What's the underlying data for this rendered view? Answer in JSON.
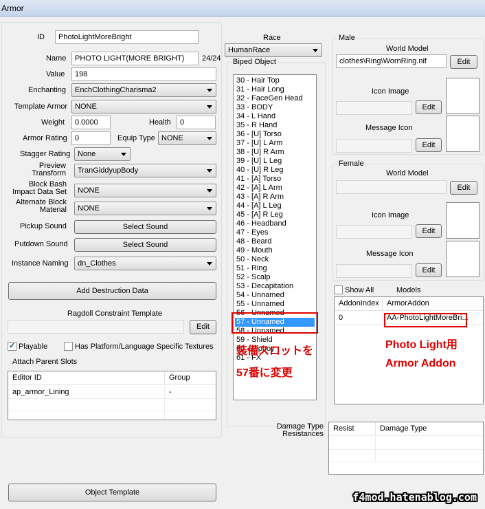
{
  "window": {
    "title": "Armor"
  },
  "form": {
    "id_label": "ID",
    "id_value": "PhotoLightMoreBright",
    "name_label": "Name",
    "name_value": "PHOTO LIGHT(MORE BRIGHT)",
    "name_count": "24/24",
    "value_label": "Value",
    "value_value": "198",
    "enchanting_label": "Enchanting",
    "enchanting_value": "EnchClothingCharisma2",
    "template_armor_label": "Template Armor",
    "template_armor_value": "NONE",
    "weight_label": "Weight",
    "weight_value": "0.0000",
    "health_label": "Health",
    "health_value": "0",
    "armor_rating_label": "Armor Rating",
    "armor_rating_value": "0",
    "equip_type_label": "Equip Type",
    "equip_type_value": "NONE",
    "stagger_label": "Stagger Rating",
    "stagger_value": "None",
    "preview_label_1": "Preview",
    "preview_label_2": "Transform",
    "preview_value": "TranGiddyupBody",
    "block_bash_label_1": "Block Bash",
    "block_bash_label_2": "Impact Data Set",
    "block_bash_value": "NONE",
    "alt_block_label_1": "Alternate Block",
    "alt_block_label_2": "Material",
    "alt_block_value": "NONE",
    "pickup_label": "Pickup Sound",
    "pickup_button": "Select Sound",
    "putdown_label": "Putdown Sound",
    "putdown_button": "Select Sound",
    "instance_label": "Instance Naming",
    "instance_value": "dn_Clothes",
    "add_destruction_button": "Add Destruction Data",
    "ragdoll_label": "Ragdoll Constraint Template",
    "ragdoll_edit": "Edit",
    "playable_label": "Playable",
    "platform_label": "Has Platform/Language Specific Textures",
    "attach_label": "Attach Parent Slots",
    "attach_columns": [
      "Editor ID",
      "Group"
    ],
    "attach_rows": [
      {
        "editor_id": "ap_armor_Lining",
        "group": "-"
      }
    ],
    "object_template_button": "Object Template"
  },
  "race": {
    "label": "Race",
    "value": "HumanRace"
  },
  "biped": {
    "label": "Biped Object",
    "items": [
      "30 - Hair Top",
      "31 - Hair Long",
      "32 - FaceGen Head",
      "33 - BODY",
      "34 - L Hand",
      "35 - R Hand",
      "36 - [U] Torso",
      "37 - [U] L Arm",
      "38 - [U] R Arm",
      "39 - [U] L Leg",
      "40 - [U] R Leg",
      "41 - [A] Torso",
      "42 - [A] L Arm",
      "43 - [A] R Arm",
      "44 - [A] L Leg",
      "45 - [A] R Leg",
      "46 - Headband",
      "47 - Eyes",
      "48 - Beard",
      "49 - Mouth",
      "50 - Neck",
      "51 - Ring",
      "52 - Scalp",
      "53 - Decapitation",
      "54 - Unnamed",
      "55 - Unnamed",
      "56 - Unnamed",
      "57 - Unnamed",
      "58 - Unnamed",
      "59 - Shield",
      "60 - Pipboy",
      "61 - FX"
    ],
    "selected_index": 27,
    "annotation_1": "装備スロットを",
    "annotation_2": "57番に変更"
  },
  "male": {
    "group_label": "Male",
    "world_model_label": "World Model",
    "world_model_value": "clothes\\Ring\\WornRing.nif",
    "world_model_edit": "Edit",
    "icon_label": "Icon Image",
    "icon_edit": "Edit",
    "message_label": "Message Icon",
    "message_edit": "Edit"
  },
  "female": {
    "group_label": "Female",
    "world_model_label": "World Model",
    "world_model_edit": "Edit",
    "icon_label": "Icon Image",
    "icon_edit": "Edit",
    "message_label": "Message Icon",
    "message_edit": "Edit"
  },
  "models": {
    "show_all_label": "Show All",
    "models_label": "Models",
    "columns": [
      "AddonIndex",
      "ArmorAddon"
    ],
    "rows": [
      {
        "index": "0",
        "addon": "AA-PhotoLightMoreBri..."
      }
    ],
    "annotation_1": "Photo Light用",
    "annotation_2": "Armor Addon"
  },
  "damage": {
    "label_1": "Damage Type",
    "label_2": "Resistances",
    "columns": [
      "Resist",
      "Damage Type"
    ]
  },
  "watermark": "f4mod.hatenablog.com"
}
